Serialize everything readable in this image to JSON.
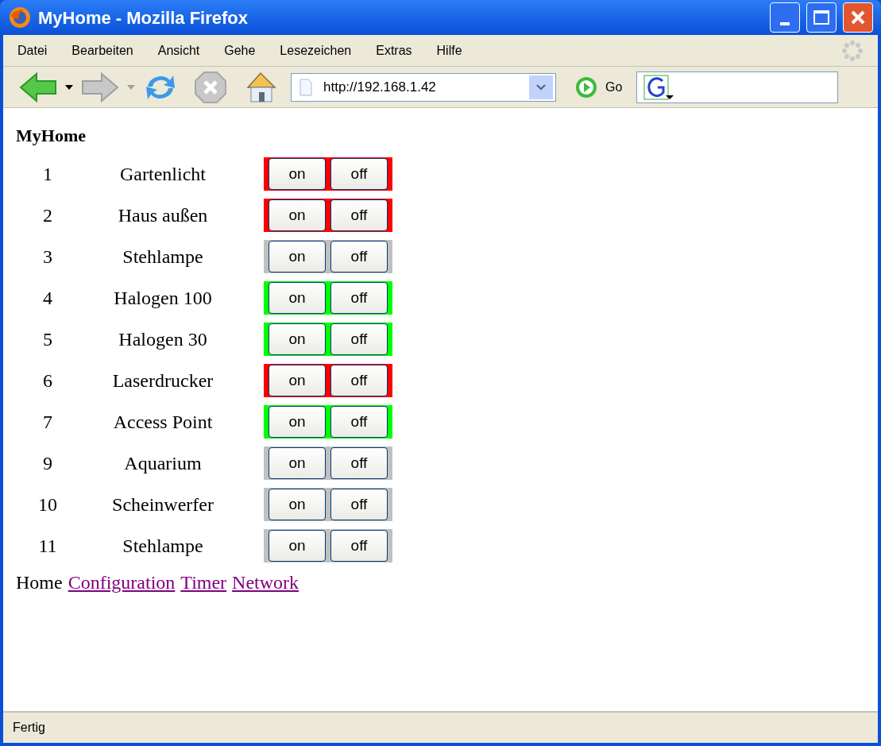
{
  "window": {
    "title": "MyHome - Mozilla Firefox"
  },
  "menu": [
    "Datei",
    "Bearbeiten",
    "Ansicht",
    "Gehe",
    "Lesezeichen",
    "Extras",
    "Hilfe"
  ],
  "toolbar": {
    "url": "http://192.168.1.42",
    "go": "Go"
  },
  "page": {
    "heading": "MyHome",
    "rows": [
      {
        "number": "1",
        "name": "Gartenlicht",
        "color": "#ff0000",
        "buttons": [
          "on",
          "off"
        ]
      },
      {
        "number": "2",
        "name": "Haus außen",
        "color": "#ff0000",
        "buttons": [
          "on",
          "off"
        ]
      },
      {
        "number": "3",
        "name": "Stehlampe",
        "color": "#c0c0c0",
        "buttons": [
          "on",
          "off"
        ]
      },
      {
        "number": "4",
        "name": "Halogen 100",
        "color": "#00ff00",
        "buttons": [
          "on",
          "off"
        ]
      },
      {
        "number": "5",
        "name": "Halogen 30",
        "color": "#00ff00",
        "buttons": [
          "on",
          "off"
        ]
      },
      {
        "number": "6",
        "name": "Laserdrucker",
        "color": "#ff0000",
        "buttons": [
          "on",
          "off"
        ]
      },
      {
        "number": "7",
        "name": "Access Point",
        "color": "#00ff00",
        "buttons": [
          "on",
          "off"
        ]
      },
      {
        "number": "9",
        "name": "Aquarium",
        "color": "#c0c0c0",
        "buttons": [
          "on",
          "off"
        ]
      },
      {
        "number": "10",
        "name": "Scheinwerfer",
        "color": "#c0c0c0",
        "buttons": [
          "on",
          "off"
        ]
      },
      {
        "number": "11",
        "name": "Stehlampe",
        "color": "#c0c0c0",
        "buttons": [
          "on",
          "off"
        ]
      }
    ],
    "nav": [
      {
        "label": "Home",
        "selected": true
      },
      {
        "label": "Configuration",
        "selected": false
      },
      {
        "label": "Timer",
        "selected": false
      },
      {
        "label": "Network",
        "selected": false
      }
    ]
  },
  "status_bar": "Fertig"
}
